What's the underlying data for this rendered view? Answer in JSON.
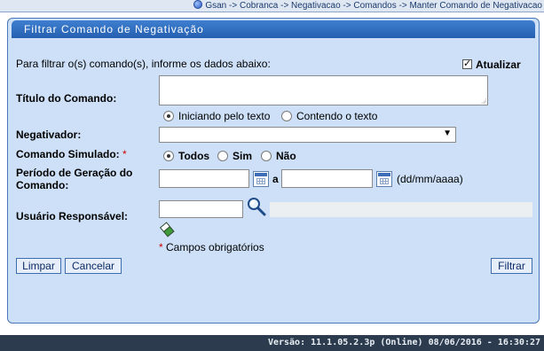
{
  "breadcrumb": "Gsan -> Cobranca -> Negativacao -> Comandos -> Manter Comando de Negativacao",
  "panel": {
    "title": "Filtrar Comando de Negativação",
    "instructions": "Para filtrar o(s) comando(s), informe os dados abaixo:",
    "atualizar_label": "Atualizar"
  },
  "form": {
    "titulo_label": "Título do Comando:",
    "titulo_value": "",
    "titulo_options": [
      "Iniciando pelo texto",
      "Contendo o texto"
    ],
    "negativador_label": "Negativador:",
    "negativador_value": "",
    "simulado_label": "Comando Simulado:",
    "required_mark": "*",
    "simulado_options": [
      "Todos",
      "Sim",
      "Não"
    ],
    "periodo_label_line1": "Período de Geração do",
    "periodo_label_line2": "Comando:",
    "periodo_sep": "a",
    "periodo_format": "(dd/mm/aaaa)",
    "usuario_label": "Usuário Responsável:",
    "required_note": "Campos obrigatórios"
  },
  "buttons": {
    "limpar": "Limpar",
    "cancelar": "Cancelar",
    "filtrar": "Filtrar"
  },
  "footer": "Versão: 11.1.05.2.3p (Online) 08/06/2016 - 16:30:27",
  "colors": {
    "panel_bg": "#cde0f7",
    "title_bar": "#2560b0",
    "footer_bg": "#2c3c4e",
    "required": "#cc0000"
  }
}
